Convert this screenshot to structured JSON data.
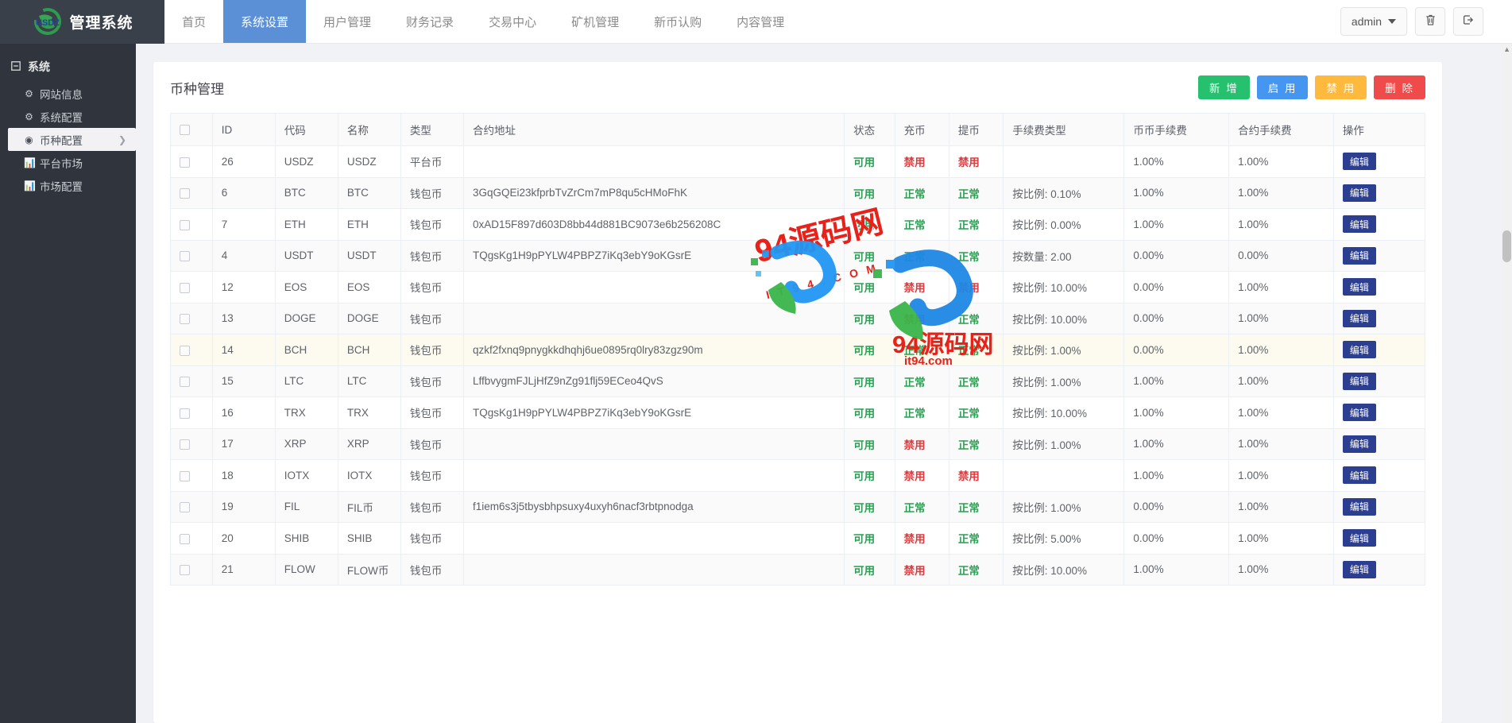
{
  "header": {
    "brand": "管理系统",
    "logo_alt": "USDZ",
    "nav": [
      {
        "label": "首页",
        "active": false
      },
      {
        "label": "系统设置",
        "active": true
      },
      {
        "label": "用户管理",
        "active": false
      },
      {
        "label": "财务记录",
        "active": false
      },
      {
        "label": "交易中心",
        "active": false
      },
      {
        "label": "矿机管理",
        "active": false
      },
      {
        "label": "新币认购",
        "active": false
      },
      {
        "label": "内容管理",
        "active": false
      }
    ],
    "user": "admin",
    "trash_icon": "trash-icon",
    "logout_icon": "logout-icon"
  },
  "sidebar": {
    "group_label": "系统",
    "items": [
      {
        "label": "网站信息",
        "icon": "gear-icon",
        "active": false,
        "chevron": false
      },
      {
        "label": "系统配置",
        "icon": "gear-icon",
        "active": false,
        "chevron": false
      },
      {
        "label": "币种配置",
        "icon": "target-icon",
        "active": true,
        "chevron": true
      },
      {
        "label": "平台市场",
        "icon": "chart-icon",
        "active": false,
        "chevron": false
      },
      {
        "label": "市场配置",
        "icon": "chart-icon",
        "active": false,
        "chevron": false
      }
    ]
  },
  "page": {
    "title": "币种管理",
    "buttons": {
      "add": "新 增",
      "enable": "启 用",
      "disable": "禁 用",
      "delete": "删 除"
    },
    "colors": {
      "add": "#25c16f",
      "enable": "#4596f0",
      "disable": "#ffb93d",
      "delete": "#f04b4b",
      "nav_active": "#5b8fd6",
      "sidebar_bg": "#30353d",
      "ok": "#2aa053",
      "bad": "#e4393c",
      "edit": "#2c3e8f"
    }
  },
  "table": {
    "columns": [
      "",
      "ID",
      "代码",
      "名称",
      "类型",
      "合约地址",
      "状态",
      "充币",
      "提币",
      "手续费类型",
      "币币手续费",
      "合约手续费",
      "操作"
    ],
    "edit_label": "编辑",
    "rows": [
      {
        "id": "26",
        "code": "USDZ",
        "name": "USDZ",
        "type": "平台币",
        "addr": "",
        "status": "可用",
        "deposit": "禁用",
        "withdraw": "禁用",
        "fee_type": "",
        "coin_fee": "1.00%",
        "contract_fee": "1.00%",
        "highlight": false
      },
      {
        "id": "6",
        "code": "BTC",
        "name": "BTC",
        "type": "钱包币",
        "addr": "3GqGQEi23kfprbTvZrCm7mP8qu5cHMoFhK",
        "status": "可用",
        "deposit": "正常",
        "withdraw": "正常",
        "fee_type": "按比例: 0.10%",
        "coin_fee": "1.00%",
        "contract_fee": "1.00%",
        "highlight": false
      },
      {
        "id": "7",
        "code": "ETH",
        "name": "ETH",
        "type": "钱包币",
        "addr": "0xAD15F897d603D8bb44d881BC9073e6b256208C",
        "status": "可用",
        "deposit": "正常",
        "withdraw": "正常",
        "fee_type": "按比例: 0.00%",
        "coin_fee": "1.00%",
        "contract_fee": "1.00%",
        "highlight": false
      },
      {
        "id": "4",
        "code": "USDT",
        "name": "USDT",
        "type": "钱包币",
        "addr": "TQgsKg1H9pPYLW4PBPZ7iKq3ebY9oKGsrE",
        "status": "可用",
        "deposit": "正常",
        "withdraw": "正常",
        "fee_type": "按数量: 2.00",
        "coin_fee": "0.00%",
        "contract_fee": "0.00%",
        "highlight": false
      },
      {
        "id": "12",
        "code": "EOS",
        "name": "EOS",
        "type": "钱包币",
        "addr": "",
        "status": "可用",
        "deposit": "禁用",
        "withdraw": "禁用",
        "fee_type": "按比例: 10.00%",
        "coin_fee": "0.00%",
        "contract_fee": "1.00%",
        "highlight": false
      },
      {
        "id": "13",
        "code": "DOGE",
        "name": "DOGE",
        "type": "钱包币",
        "addr": "",
        "status": "可用",
        "deposit": "禁用",
        "withdraw": "正常",
        "fee_type": "按比例: 10.00%",
        "coin_fee": "0.00%",
        "contract_fee": "1.00%",
        "highlight": false
      },
      {
        "id": "14",
        "code": "BCH",
        "name": "BCH",
        "type": "钱包币",
        "addr": "qzkf2fxnq9pnygkkdhqhj6ue0895rq0lry83zgz90m",
        "status": "可用",
        "deposit": "正常",
        "withdraw": "正常",
        "fee_type": "按比例: 1.00%",
        "coin_fee": "0.00%",
        "contract_fee": "1.00%",
        "highlight": true
      },
      {
        "id": "15",
        "code": "LTC",
        "name": "LTC",
        "type": "钱包币",
        "addr": "LffbvygmFJLjHfZ9nZg91flj59ECeo4QvS",
        "status": "可用",
        "deposit": "正常",
        "withdraw": "正常",
        "fee_type": "按比例: 1.00%",
        "coin_fee": "1.00%",
        "contract_fee": "1.00%",
        "highlight": false
      },
      {
        "id": "16",
        "code": "TRX",
        "name": "TRX",
        "type": "钱包币",
        "addr": "TQgsKg1H9pPYLW4PBPZ7iKq3ebY9oKGsrE",
        "status": "可用",
        "deposit": "正常",
        "withdraw": "正常",
        "fee_type": "按比例: 10.00%",
        "coin_fee": "1.00%",
        "contract_fee": "1.00%",
        "highlight": false
      },
      {
        "id": "17",
        "code": "XRP",
        "name": "XRP",
        "type": "钱包币",
        "addr": "",
        "status": "可用",
        "deposit": "禁用",
        "withdraw": "正常",
        "fee_type": "按比例: 1.00%",
        "coin_fee": "1.00%",
        "contract_fee": "1.00%",
        "highlight": false
      },
      {
        "id": "18",
        "code": "IOTX",
        "name": "IOTX",
        "type": "钱包币",
        "addr": "",
        "status": "可用",
        "deposit": "禁用",
        "withdraw": "禁用",
        "fee_type": "",
        "coin_fee": "1.00%",
        "contract_fee": "1.00%",
        "highlight": false
      },
      {
        "id": "19",
        "code": "FIL",
        "name": "FIL币",
        "type": "钱包币",
        "addr": "f1iem6s3j5tbysbhpsuxy4uxyh6nacf3rbtpnodga",
        "status": "可用",
        "deposit": "正常",
        "withdraw": "正常",
        "fee_type": "按比例: 1.00%",
        "coin_fee": "0.00%",
        "contract_fee": "1.00%",
        "highlight": false
      },
      {
        "id": "20",
        "code": "SHIB",
        "name": "SHIB",
        "type": "钱包币",
        "addr": "",
        "status": "可用",
        "deposit": "禁用",
        "withdraw": "正常",
        "fee_type": "按比例: 5.00%",
        "coin_fee": "0.00%",
        "contract_fee": "1.00%",
        "highlight": false
      },
      {
        "id": "21",
        "code": "FLOW",
        "name": "FLOW币",
        "type": "钱包币",
        "addr": "",
        "status": "可用",
        "deposit": "禁用",
        "withdraw": "正常",
        "fee_type": "按比例: 10.00%",
        "coin_fee": "1.00%",
        "contract_fee": "1.00%",
        "highlight": false
      }
    ]
  },
  "watermark": {
    "main": "94源码网",
    "spaced": "IT94.COM",
    "mid": "94源码网",
    "domain": "it94.com"
  }
}
